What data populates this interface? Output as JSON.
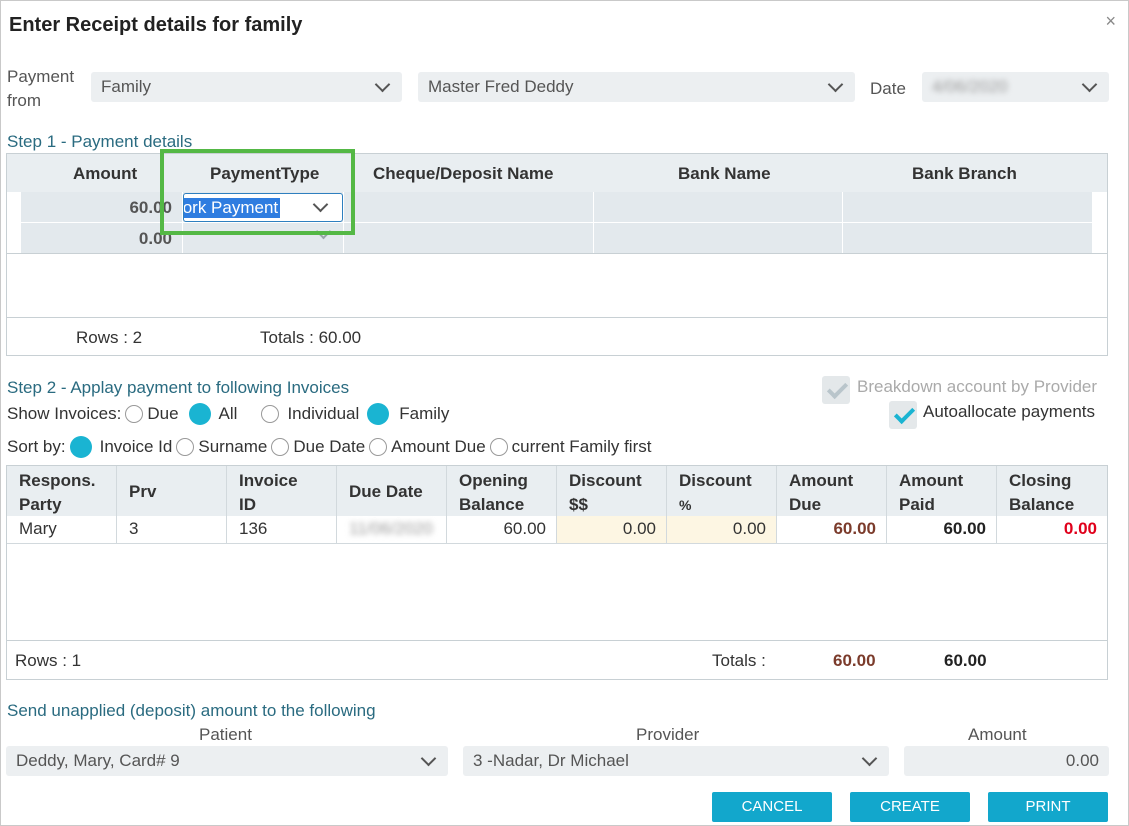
{
  "dialog": {
    "title": "Enter Receipt details for family",
    "close_icon": "×"
  },
  "payment_from": {
    "label_line1": "Payment",
    "label_line2": "from",
    "type_value": "Family",
    "person_value": "Master Fred  Deddy",
    "date_label": "Date",
    "date_value": "4/06/2020"
  },
  "step1": {
    "heading": "Step 1 - Payment details",
    "columns": [
      "Amount",
      "PaymentType",
      "Cheque/Deposit Name",
      "Bank Name",
      "Bank Branch"
    ],
    "rows": [
      {
        "amount": "60.00",
        "payment_type": "/ork Payment"
      },
      {
        "amount": "0.00",
        "payment_type": ""
      }
    ],
    "rows_label": "Rows : 2",
    "totals_label": "Totals : 60.00"
  },
  "step2": {
    "heading": "Step 2 - Applay payment to following Invoices",
    "show_invoices_label": "Show Invoices:",
    "show_options": [
      "Due",
      "All",
      "Individual",
      "Family"
    ],
    "show_selected": [
      "All",
      "Family"
    ],
    "sort_label": "Sort by:",
    "sort_options": [
      "Invoice Id",
      "Surname",
      "Due Date",
      "Amount Due",
      "current Family first"
    ],
    "sort_selected": "Invoice Id",
    "breakdown_label": "Breakdown account by Provider",
    "autoallocate_label": "Autoallocate payments"
  },
  "invoices": {
    "headers": [
      [
        "Respons.",
        "Party"
      ],
      [
        "Prv",
        ""
      ],
      [
        "Invoice",
        "ID"
      ],
      [
        "Due Date",
        ""
      ],
      [
        "Opening",
        "Balance"
      ],
      [
        "Discount",
        "$$"
      ],
      [
        "Discount",
        "%"
      ],
      [
        "Amount",
        "Due"
      ],
      [
        "Amount",
        "Paid"
      ],
      [
        "Closing",
        "Balance"
      ]
    ],
    "rows": [
      {
        "party": "Mary",
        "prv": "3",
        "invoice_id": "136",
        "due_date": "11/06/2020",
        "opening_balance": "60.00",
        "discount_dollars": "0.00",
        "discount_pct": "0.00",
        "amount_due": "60.00",
        "amount_paid": "60.00",
        "closing_balance": "0.00"
      }
    ],
    "rows_label": "Rows : 1",
    "totals_label": "Totals :",
    "total_due": "60.00",
    "total_paid": "60.00"
  },
  "unapplied": {
    "heading": "Send unapplied (deposit) amount to the following",
    "patient_label": "Patient",
    "patient_value": "Deddy, Mary, Card# 9",
    "provider_label": "Provider",
    "provider_value": "3 -Nadar, Dr Michael",
    "amount_label": "Amount",
    "amount_value": "0.00"
  },
  "buttons": {
    "cancel": "CANCEL",
    "create": "CREATE",
    "print": "PRINT"
  },
  "colors": {
    "accent": "#12a7cc",
    "due_color": "#7b3b2b",
    "closing_color": "#e0001b",
    "highlight": "#54b845"
  }
}
